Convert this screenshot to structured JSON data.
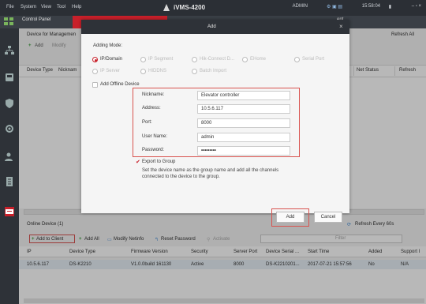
{
  "window": {
    "menu": [
      "File",
      "System",
      "View",
      "Tool",
      "Help"
    ],
    "title": "iVMS-4200",
    "user": "ADMIN",
    "time": "15:58:04",
    "controls": "–  ▫  ×"
  },
  "tabs": {
    "control_panel": "Control Panel",
    "partial_right": "ent"
  },
  "device_mgmt": {
    "title": "Device for Managemen",
    "refresh_all": "Refresh All",
    "add": "Add",
    "modify": "Modify",
    "columns": [
      "Device Type",
      "Nicknam",
      "Net Status",
      "Refresh"
    ]
  },
  "modal": {
    "title": "Add",
    "close": "×",
    "adding_mode_label": "Adding Mode:",
    "modes_row1": [
      "IP/Domain",
      "IP Segment",
      "Hik-Connect D...",
      "EHome",
      "Serial Port"
    ],
    "modes_row2": [
      "IP Server",
      "HIDDNS",
      "Batch Import"
    ],
    "offline_label": "Add Offline Device",
    "fields": [
      {
        "label": "Nickname:",
        "value": "Elevator controller"
      },
      {
        "label": "Address:",
        "value": "10.5.6.117"
      },
      {
        "label": "Port:",
        "value": "8000"
      },
      {
        "label": "User Name:",
        "value": "admin"
      },
      {
        "label": "Password:",
        "value": "•••••••••"
      }
    ],
    "export_label": "Export to Group",
    "note": "Set the device name as the group name and add all the channels connected to the device to the group.",
    "add_button": "Add",
    "cancel_button": "Cancel"
  },
  "online": {
    "title": "Online Device (1)",
    "refresh": "Refresh Every 60s",
    "toolbar": [
      "Add to Client",
      "Add All",
      "Modify Netinfo",
      "Reset Password",
      "Activate"
    ],
    "filter_placeholder": "Filter",
    "columns": [
      "IP",
      "Device Type",
      "Firmware Version",
      "Security",
      "Server Port",
      "Device Serial ...",
      "Start Time",
      "Added",
      "Support I"
    ],
    "row": [
      "10.5.6.117",
      "DS-K2210",
      "V1.0.0build 161130",
      "Active",
      "8000",
      "DS-K2210201...",
      "2017-07-21 15:57:56",
      "No",
      "N/A"
    ]
  },
  "colors": {
    "accent_red": "#c8202a",
    "highlight_red": "#d9534f",
    "titlebar": "#2b2f35"
  }
}
